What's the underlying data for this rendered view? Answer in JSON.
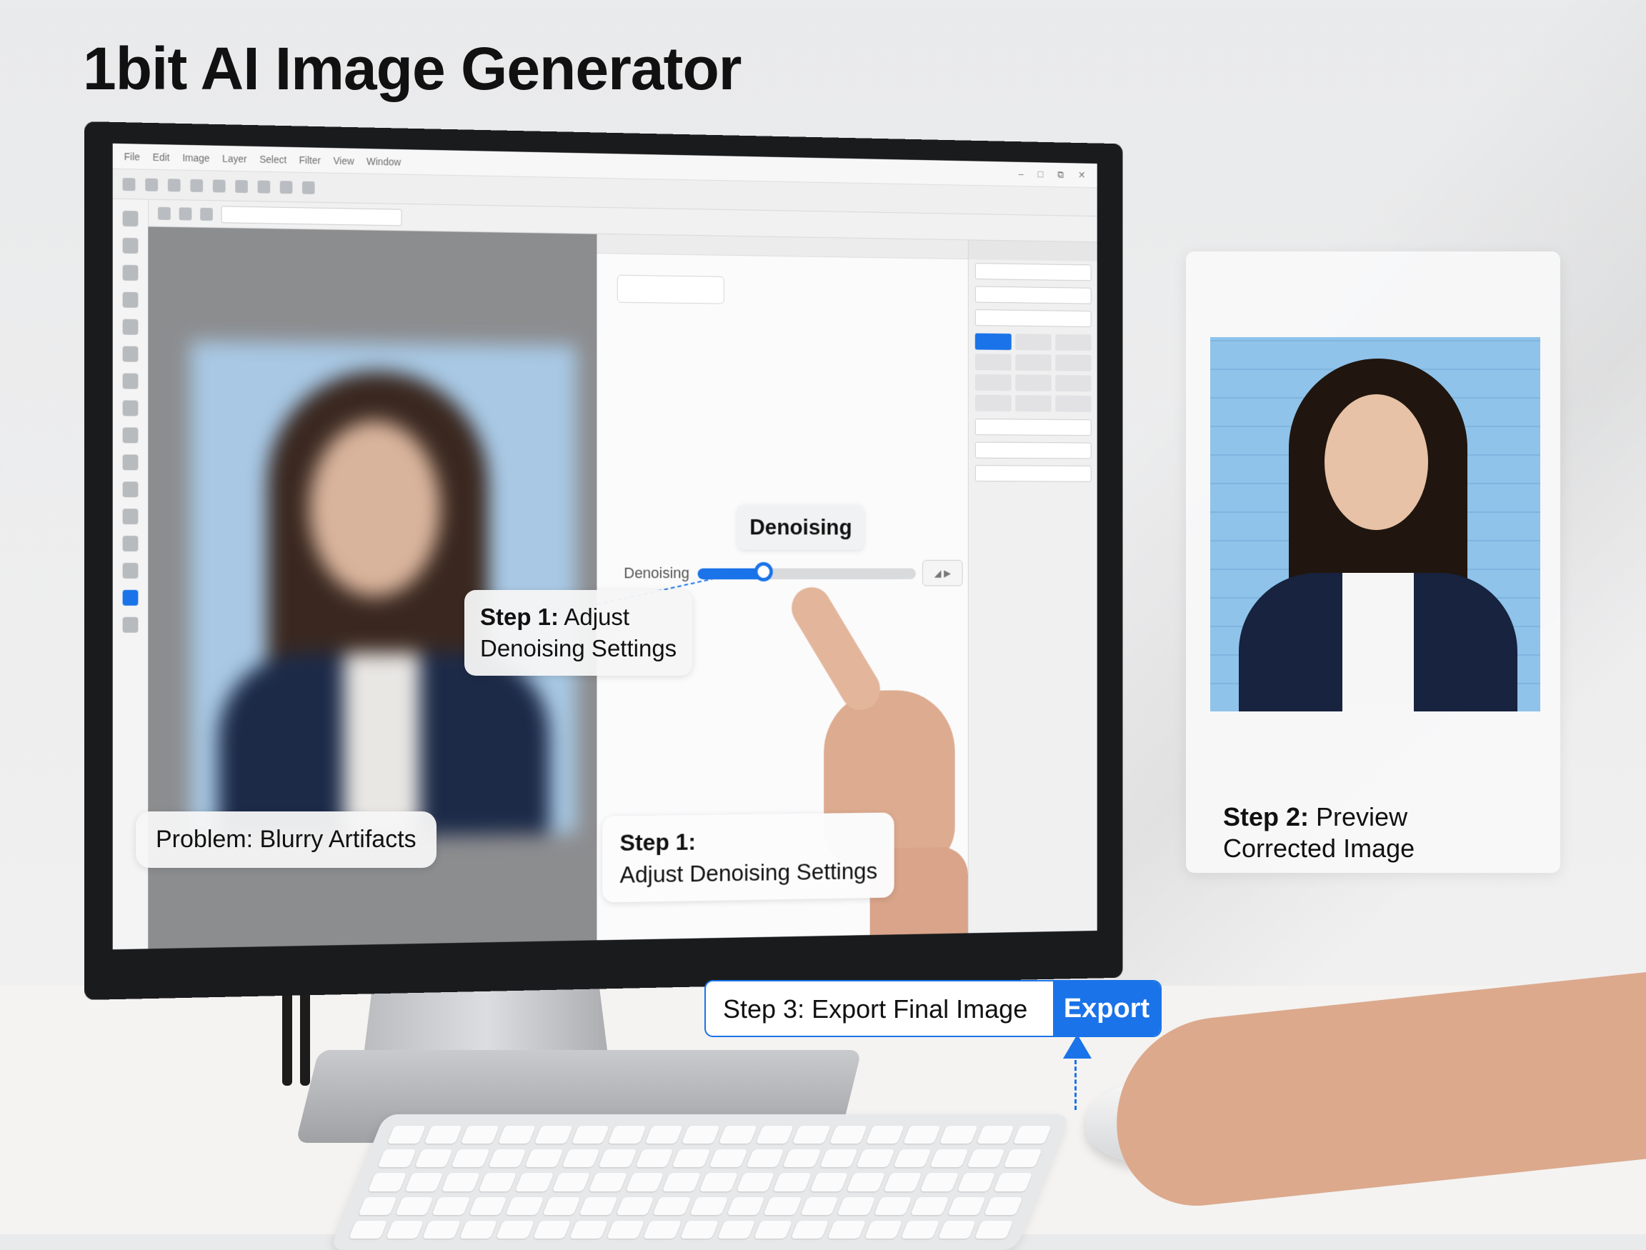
{
  "title": "1bit AI Image Generator",
  "app": {
    "menu_items": [
      "File",
      "Edit",
      "Image",
      "Layer",
      "Select",
      "Filter",
      "View",
      "Window"
    ],
    "window_controls": [
      "–",
      "□",
      "⧉",
      "✕"
    ],
    "toolbar_combo": "",
    "middle_panel_title": "",
    "mode_select": "",
    "right_panel_title": ""
  },
  "left_panel": {
    "problem_label": "Problem: Blurry Artifacts"
  },
  "middle_panel": {
    "tooltip": "Denoising",
    "slider_label": "Denoising",
    "slider_value": 0.3,
    "step1_inline_bold": "Step 1:",
    "step1_inline_line1": " Adjust",
    "step1_inline_line2": "Denoising Settings",
    "step1_bottom_bold": "Step 1:",
    "step1_bottom_line2": "Adjust Denoising Settings"
  },
  "preview": {
    "caption_bold": "Step 2:",
    "caption_line1": " Preview",
    "caption_line2": "Corrected Image"
  },
  "export": {
    "label": "Step 3: Export Final Image",
    "button": "Export"
  },
  "colors": {
    "accent": "#1a73e8"
  },
  "icons": [
    "move-icon",
    "lasso-icon",
    "crop-icon",
    "brush-icon",
    "eraser-icon",
    "zoom-icon",
    "text-icon",
    "shape-icon"
  ]
}
